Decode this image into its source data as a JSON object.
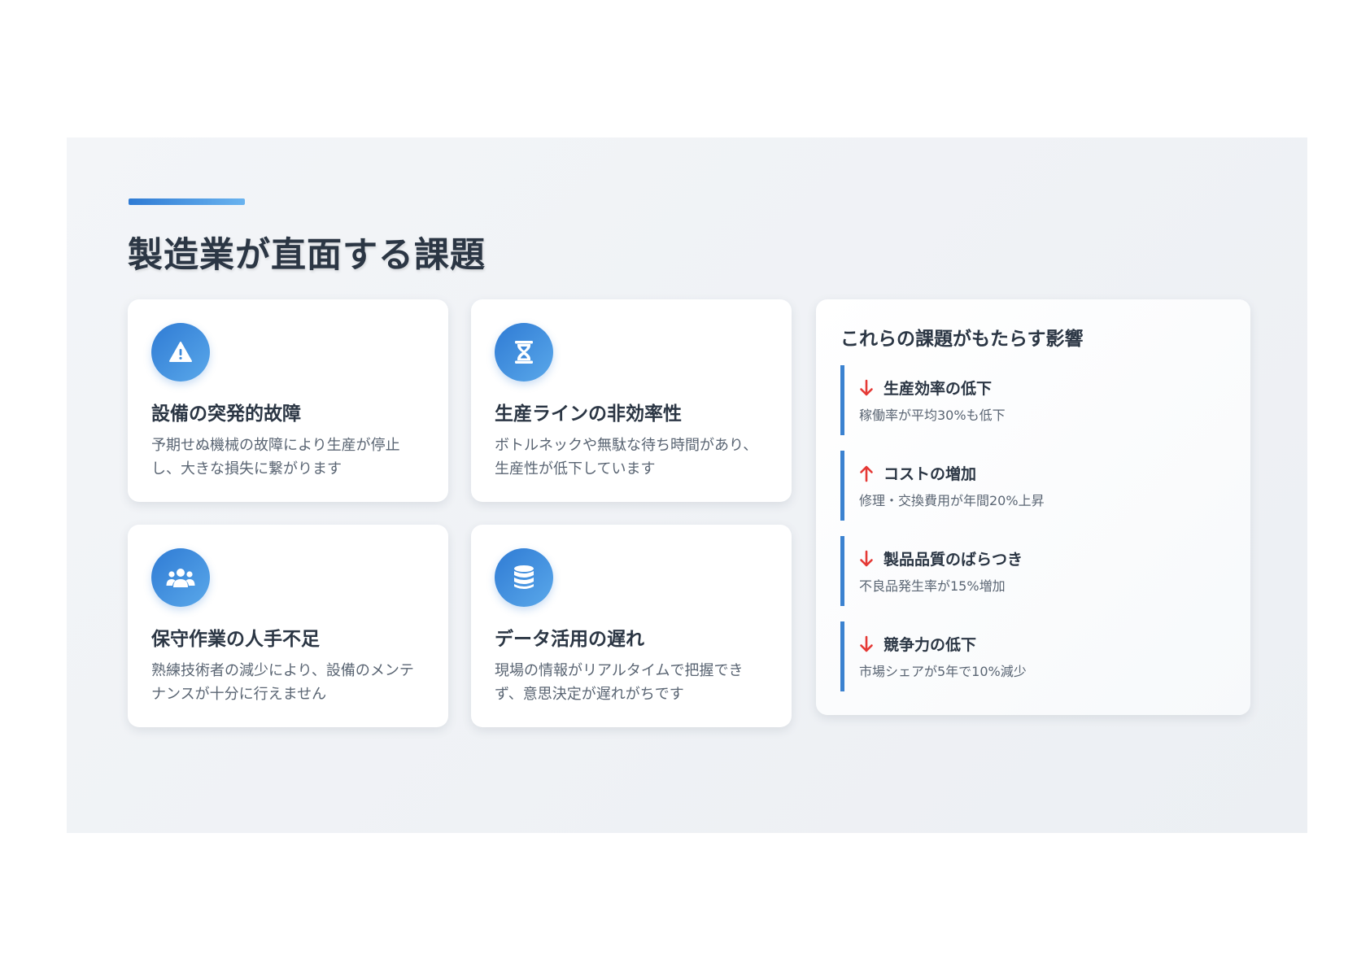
{
  "title": "製造業が直面する課題",
  "colors": {
    "accent_start": "#2f7bd4",
    "accent_end": "#6ab3ef",
    "arrow": "#e53935",
    "impact_border": "#3b82d0"
  },
  "cards": [
    {
      "icon": "warning-icon",
      "title": "設備の突発的故障",
      "description": "予期せぬ機械の故障により生産が停止し、大きな損失に繋がります"
    },
    {
      "icon": "hourglass-icon",
      "title": "生産ラインの非効率性",
      "description": "ボトルネックや無駄な待ち時間があり、生産性が低下しています"
    },
    {
      "icon": "users-icon",
      "title": "保守作業の人手不足",
      "description": "熟練技術者の減少により、設備のメンテナンスが十分に行えません"
    },
    {
      "icon": "database-icon",
      "title": "データ活用の遅れ",
      "description": "現場の情報がリアルタイムで把握できず、意思決定が遅れがちです"
    }
  ],
  "impact": {
    "title": "これらの課題がもたらす影響",
    "items": [
      {
        "direction": "down",
        "icon": "arrow-down-icon",
        "label": "生産効率の低下",
        "detail": "稼働率が平均30%も低下"
      },
      {
        "direction": "up",
        "icon": "arrow-up-icon",
        "label": "コストの増加",
        "detail": "修理・交換費用が年間20%上昇"
      },
      {
        "direction": "down",
        "icon": "arrow-down-icon",
        "label": "製品品質のばらつき",
        "detail": "不良品発生率が15%増加"
      },
      {
        "direction": "down",
        "icon": "arrow-down-icon",
        "label": "競争力の低下",
        "detail": "市場シェアが5年で10%減少"
      }
    ]
  }
}
